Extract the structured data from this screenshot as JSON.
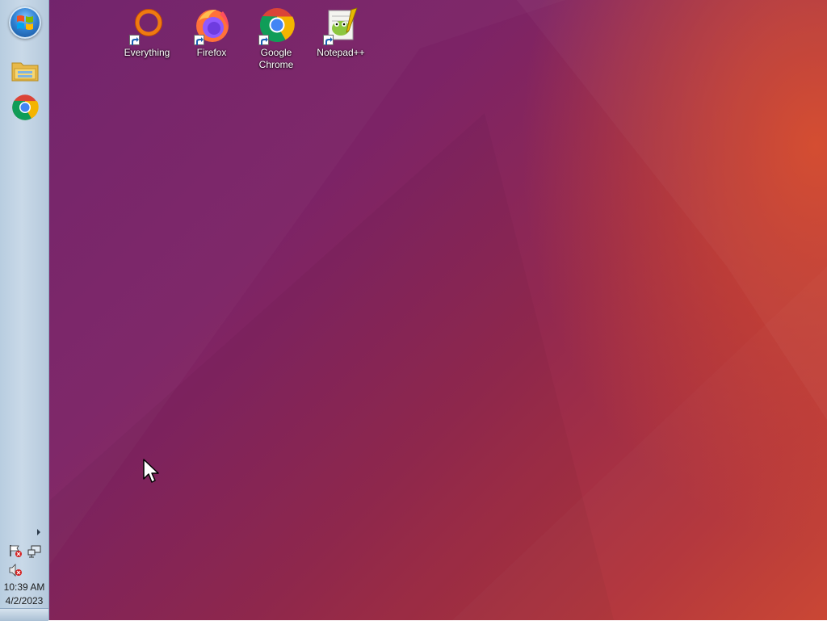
{
  "desktop": {
    "icons": [
      {
        "label": "Everything",
        "icon": "everything-icon"
      },
      {
        "label": "Firefox",
        "icon": "firefox-icon"
      },
      {
        "label": "Google\nChrome",
        "icon": "chrome-icon"
      },
      {
        "label": "Notepad++",
        "icon": "notepadpp-icon"
      }
    ]
  },
  "taskbar": {
    "start": {
      "icon": "windows-start-icon"
    },
    "pinned": [
      {
        "name": "File Explorer",
        "icon": "folder-icon"
      },
      {
        "name": "Google Chrome",
        "icon": "chrome-icon"
      }
    ],
    "tray": {
      "icons": [
        "action-center-flag-icon",
        "network-icon",
        "volume-muted-icon"
      ]
    },
    "clock": {
      "time": "10:39 AM",
      "date": "4/2/2023"
    }
  },
  "colors": {
    "taskbar": "#c9d9e8",
    "wallpaper_purple": "#6e1f6a",
    "wallpaper_orange": "#c94430"
  }
}
